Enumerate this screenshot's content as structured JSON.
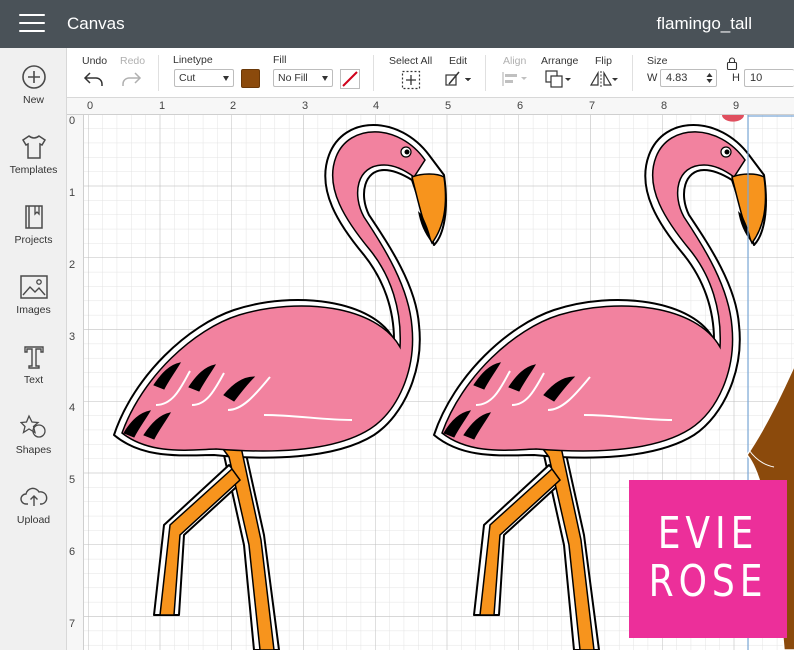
{
  "header": {
    "app_title": "Canvas",
    "doc_title": "flamingo_tall"
  },
  "sidebar": {
    "items": [
      {
        "label": "New",
        "icon": "plus-circle-icon"
      },
      {
        "label": "Templates",
        "icon": "tshirt-icon"
      },
      {
        "label": "Projects",
        "icon": "book-icon"
      },
      {
        "label": "Images",
        "icon": "image-icon"
      },
      {
        "label": "Text",
        "icon": "text-t-icon"
      },
      {
        "label": "Shapes",
        "icon": "shapes-icon"
      },
      {
        "label": "Upload",
        "icon": "upload-cloud-icon"
      }
    ]
  },
  "toolbar": {
    "undo": "Undo",
    "redo": "Redo",
    "linetype_label": "Linetype",
    "linetype_value": "Cut",
    "fill_label": "Fill",
    "fill_value": "No Fill",
    "fill_color": "#8b4a0c",
    "select_all": "Select All",
    "edit": "Edit",
    "align": "Align",
    "arrange": "Arrange",
    "flip": "Flip",
    "size_label": "Size",
    "w_label": "W",
    "w_value": "4.83",
    "h_label": "H",
    "h_value": "10"
  },
  "ruler": {
    "top": [
      "0",
      "1",
      "2",
      "3",
      "4",
      "5",
      "6",
      "7",
      "8",
      "9"
    ],
    "left": [
      "0",
      "1",
      "2",
      "3",
      "4",
      "5",
      "6",
      "7"
    ]
  },
  "watermark": {
    "line1": "EVIE",
    "line2": "ROSE",
    "color": "#ec2f9a"
  },
  "colors": {
    "flamingo_pink": "#f2829f",
    "leg_orange": "#f7941d",
    "beak_orange": "#f7941d",
    "selection_blue": "#7aa7d6"
  }
}
